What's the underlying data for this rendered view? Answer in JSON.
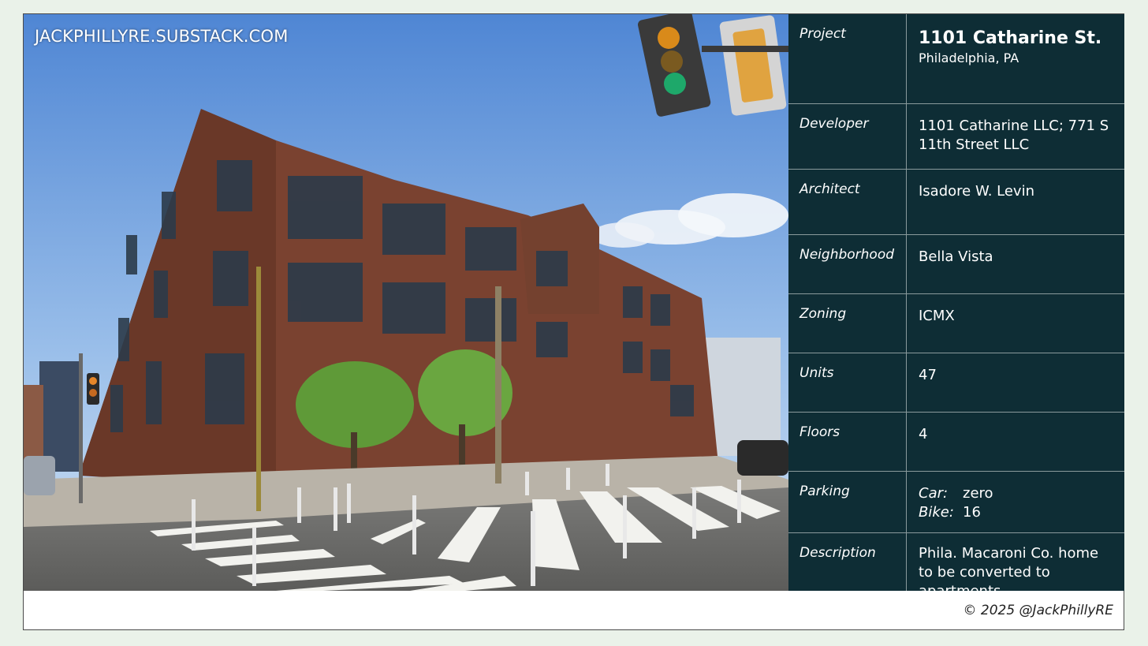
{
  "watermark": "JACKPHILLYRE.SUBSTACK.COM",
  "info": {
    "project": {
      "label": "Project",
      "title": "1101 Catharine St.",
      "subtitle": "Philadelphia, PA"
    },
    "developer": {
      "label": "Developer",
      "value": "1101 Catharine LLC; 771 S 11th Street LLC"
    },
    "architect": {
      "label": "Architect",
      "value": "Isadore W. Levin"
    },
    "neighborhood": {
      "label": "Neighborhood",
      "value": "Bella Vista"
    },
    "zoning": {
      "label": "Zoning",
      "value": "ICMX"
    },
    "units": {
      "label": "Units",
      "value": "47"
    },
    "floors": {
      "label": "Floors",
      "value": "4"
    },
    "parking": {
      "label": "Parking",
      "car_label": "Car:",
      "car_value": "zero",
      "bike_label": "Bike:",
      "bike_value": "16"
    },
    "description": {
      "label": "Description",
      "value": "Phila. Macaroni Co. home to be converted to apartments"
    }
  },
  "footer": "© 2025 @JackPhillyRE",
  "colors": {
    "panel": "#0e2d35",
    "page_background": "#eaf2e9",
    "brick": "#6e3a2a",
    "sky": "#6fa0d8"
  }
}
